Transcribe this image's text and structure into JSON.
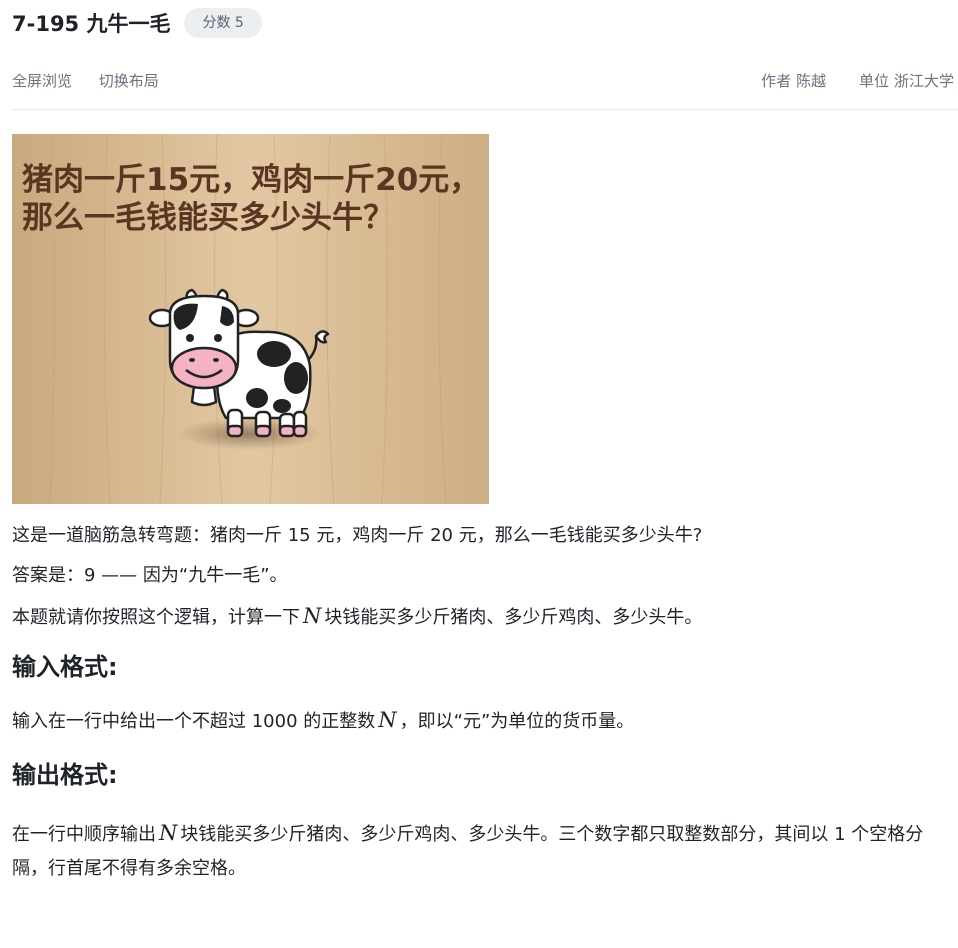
{
  "problem": {
    "title": "7-195 九牛一毛",
    "score_badge": "分数 5"
  },
  "toolbar": {
    "fullscreen_label": "全屏浏览",
    "switch_layout_label": "切换布局"
  },
  "meta": {
    "author_label": "作者",
    "author_value": "陈越",
    "unit_label": "单位",
    "unit_value": "浙江大学"
  },
  "image": {
    "caption_line1": "猪肉一斤15元，鸡肉一斤20元，",
    "caption_line2": "那么一毛钱能买多少头牛？"
  },
  "statement": {
    "p1": "这是一道脑筋急转弯题：猪肉一斤 15 元，鸡肉一斤 20 元，那么一毛钱能买多少头牛?",
    "p2": "答案是：9 —— 因为“九牛一毛”。",
    "p3_before": "本题就请你按照这个逻辑，计算一下",
    "p3_var": "N",
    "p3_after": "块钱能买多少斤猪肉、多少斤鸡肉、多少头牛。"
  },
  "input_section": {
    "heading": "输入格式:",
    "text_before": "输入在一行中给出一个不超过 1000 的正整数",
    "var": "N",
    "text_after": "，即以“元”为单位的货币量。"
  },
  "output_section": {
    "heading": "输出格式:",
    "text_before": "在一行中顺序输出",
    "var": "N",
    "text_after": "块钱能买多少斤猪肉、多少斤鸡肉、多少头牛。三个数字都只取整数部分，其间以 1 个空格分隔，行首尾不得有多余空格。"
  },
  "colors": {
    "accent_badge_bg": "#eceef1",
    "wood": "#dcc19b",
    "caption_text": "#5a3521",
    "cow_nose": "#f4b3c2"
  }
}
